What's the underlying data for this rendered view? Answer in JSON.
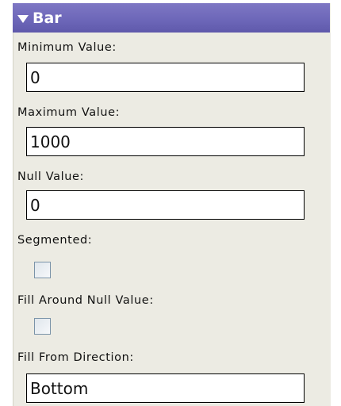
{
  "section": {
    "title": "Bar"
  },
  "fields": {
    "minimum": {
      "label": "Minimum Value:",
      "value": "0"
    },
    "maximum": {
      "label": "Maximum Value:",
      "value": "1000"
    },
    "null_value": {
      "label": "Null Value:",
      "value": "0"
    },
    "segmented": {
      "label": "Segmented:",
      "checked": false
    },
    "fill_around": {
      "label": "Fill Around Null Value:",
      "checked": false
    },
    "fill_direction": {
      "label": "Fill From Direction:",
      "value": "Bottom"
    }
  }
}
